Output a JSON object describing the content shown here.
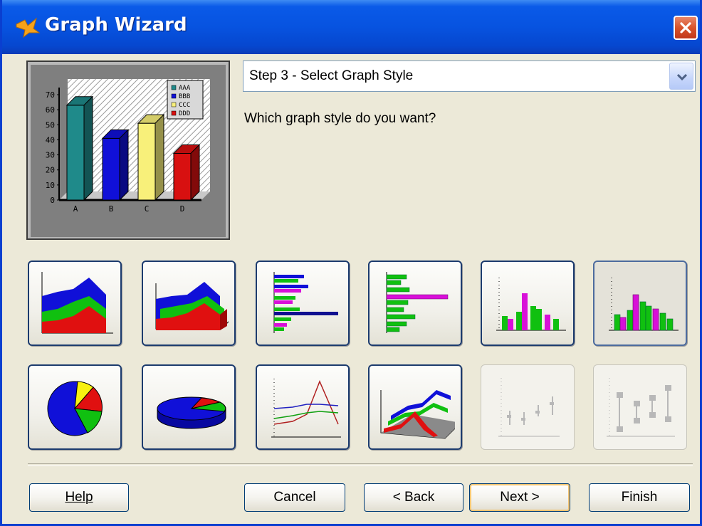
{
  "window": {
    "title": "Graph Wizard",
    "icon": "wizard-app-icon",
    "close_icon": "close-x-icon"
  },
  "preview": {
    "chart_data": {
      "type": "bar",
      "categories": [
        "A",
        "B",
        "C",
        "D"
      ],
      "values": [
        63,
        41,
        51,
        31
      ],
      "ylim": [
        0,
        70
      ],
      "yticks": [
        "70",
        "60",
        "50",
        "40",
        "30",
        "20",
        "10",
        "0"
      ],
      "legend": [
        "AAA",
        "BBB",
        "CCC",
        "DDD"
      ],
      "legend_position": "top-right",
      "colors": [
        "#1f8a8a",
        "#1010d8",
        "#f8f07a",
        "#d81010"
      ],
      "style": "3d-bar"
    }
  },
  "step_select": {
    "value": "Step 3 - Select Graph Style",
    "dropdown_icon": "chevron-down-icon"
  },
  "question": "Which graph style do you want?",
  "styles": [
    {
      "name": "area-chart-style",
      "icon": "area-chart-icon",
      "selected": false,
      "enabled": true
    },
    {
      "name": "3d-area-chart-style",
      "icon": "area-3d-chart-icon",
      "selected": false,
      "enabled": true
    },
    {
      "name": "horizontal-bar-style",
      "icon": "hbar-chart-icon",
      "selected": false,
      "enabled": true
    },
    {
      "name": "3d-horizontal-bar-style",
      "icon": "hbar-3d-chart-icon",
      "selected": false,
      "enabled": true
    },
    {
      "name": "column-chart-style",
      "icon": "column-chart-icon",
      "selected": false,
      "enabled": true
    },
    {
      "name": "3d-column-chart-style",
      "icon": "column-3d-chart-icon",
      "selected": true,
      "enabled": true
    },
    {
      "name": "pie-chart-style",
      "icon": "pie-chart-icon",
      "selected": false,
      "enabled": true
    },
    {
      "name": "3d-pie-chart-style",
      "icon": "pie-3d-chart-icon",
      "selected": false,
      "enabled": true
    },
    {
      "name": "line-chart-style",
      "icon": "line-chart-icon",
      "selected": false,
      "enabled": true
    },
    {
      "name": "3d-line-chart-style",
      "icon": "line-3d-chart-icon",
      "selected": false,
      "enabled": true
    },
    {
      "name": "hi-lo-chart-style",
      "icon": "hilo-chart-icon",
      "selected": false,
      "enabled": false
    },
    {
      "name": "candlestick-chart-style",
      "icon": "candlestick-chart-icon",
      "selected": false,
      "enabled": false
    }
  ],
  "buttons": {
    "help": "Help",
    "cancel": "Cancel",
    "back": "< Back",
    "next": "Next >",
    "finish": "Finish"
  },
  "colors": {
    "titlebar": "#0753e0",
    "dialog_bg": "#ece9d8",
    "tile_border": "#1c3b6e",
    "default_button_glow": "#f3c473"
  }
}
